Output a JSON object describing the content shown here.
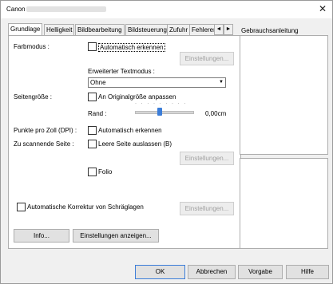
{
  "window": {
    "title": "Canon",
    "close_glyph": "✕"
  },
  "tabs": [
    "Grundlage",
    "Helligkeit",
    "Bildbearbeitung",
    "Bildsteuerung",
    "Zufuhr",
    "Fehlererk"
  ],
  "tab_arrows": [
    "◄",
    "►"
  ],
  "help": {
    "title": "Gebrauchsanleitung"
  },
  "farbmodus": {
    "label": "Farbmodus :",
    "auto_label": "Automatisch erkennen",
    "settings_button": "Einstellungen..."
  },
  "textmodus": {
    "label": "Erweiterter Textmodus :",
    "value": "Ohne"
  },
  "seitengroesse": {
    "label": "Seitengröße :",
    "match_label": "An Originalgröße anpassen",
    "rand_label": "Rand :",
    "rand_value": "0,00cm"
  },
  "dpi": {
    "label": "Punkte pro Zoll (DPI) :",
    "auto_label": "Automatisch erkennen"
  },
  "scan_side": {
    "label": "Zu scannende Seite :",
    "skip_blank_label": "Leere Seite auslassen (B)",
    "settings_button": "Einstellungen...",
    "folio_label": "Folio"
  },
  "skew": {
    "label": "Automatische Korrektur von Schräglagen",
    "settings_button": "Einstellungen..."
  },
  "buttons": {
    "info": "Info...",
    "show_settings": "Einstellungen anzeigen..."
  },
  "footer": {
    "ok": "OK",
    "cancel": "Abbrechen",
    "default": "Vorgabe",
    "help": "Hilfe"
  }
}
